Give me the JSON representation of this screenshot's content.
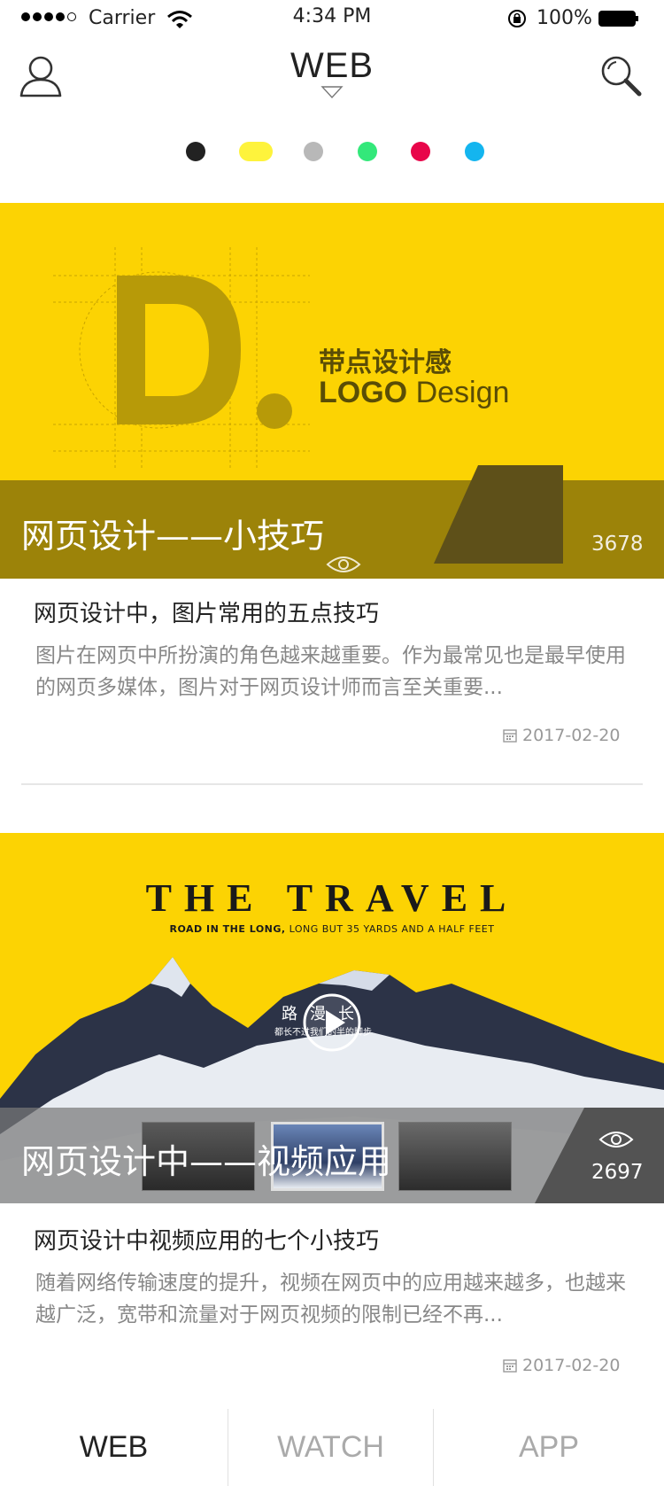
{
  "status_bar": {
    "carrier": "Carrier",
    "time": "4:34 PM",
    "battery": "100%"
  },
  "header": {
    "title": "WEB",
    "user_icon": "user-icon",
    "search_icon": "search-icon"
  },
  "color_filters": [
    "#222222",
    "#fef33c",
    "#b8b8b8",
    "#33e87a",
    "#e8064a",
    "#14b5ef"
  ],
  "articles": [
    {
      "banner_heading_cn": "带点设计感",
      "banner_heading_en_bold": "LOGO",
      "banner_heading_en": "Design",
      "overlay_title": "网页设计——小技巧",
      "views": "3678",
      "title": "网页设计中，图片常用的五点技巧",
      "description": "图片在网页中所扮演的角色越来越重要。作为最常见也是最早使用的网页多媒体，图片对于网页设计师而言至关重要...",
      "date": "2017-02-20"
    },
    {
      "banner_heading": "THE TRAVEL",
      "banner_sub_bold": "ROAD IN THE LONG,",
      "banner_sub": "LONG BUT 35 YARDS AND A HALF FEET",
      "banner_cn": "路漫长",
      "banner_cn_sub": "都长不过我们的半的脚步",
      "overlay_title": "网页设计中——视频应用",
      "views": "2697",
      "title": "网页设计中视频应用的七个小技巧",
      "description": "随着网络传输速度的提升，视频在网页中的应用越来越多，也越来越广泛，宽带和流量对于网页视频的限制已经不再...",
      "date": "2017-02-20"
    }
  ],
  "tabs": [
    {
      "label": "WEB",
      "active": true
    },
    {
      "label": "WATCH",
      "active": false
    },
    {
      "label": "APP",
      "active": false
    }
  ],
  "colors": {
    "accent_yellow": "#fcd303",
    "tab_active": "#222222",
    "tab_inactive": "#aaaaaa"
  }
}
